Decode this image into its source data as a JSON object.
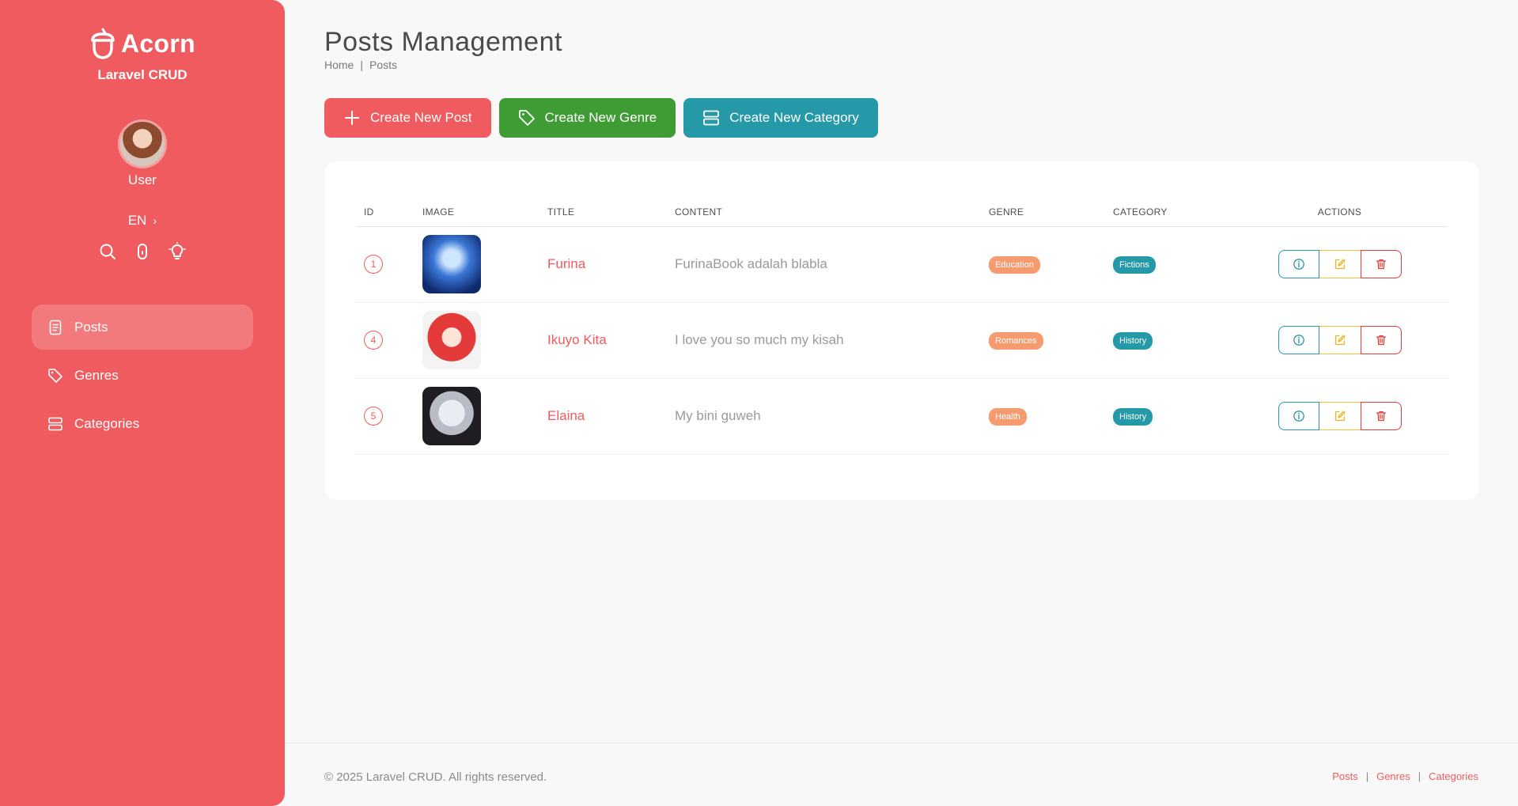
{
  "brand": {
    "name": "Acorn",
    "subtitle": "Laravel CRUD"
  },
  "user": {
    "name": "User"
  },
  "language": {
    "code": "EN"
  },
  "sidebar": {
    "items": [
      {
        "label": "Posts",
        "icon": "document-icon",
        "active": true
      },
      {
        "label": "Genres",
        "icon": "tag-icon",
        "active": false
      },
      {
        "label": "Categories",
        "icon": "category-icon",
        "active": false
      }
    ]
  },
  "page": {
    "title": "Posts Management",
    "breadcrumb": [
      "Home",
      "Posts"
    ]
  },
  "toolbar": {
    "create_post": "Create New Post",
    "create_genre": "Create New Genre",
    "create_category": "Create New Category"
  },
  "table": {
    "headers": [
      "ID",
      "IMAGE",
      "TITLE",
      "CONTENT",
      "GENRE",
      "CATEGORY",
      "ACTIONS"
    ],
    "rows": [
      {
        "id": "1",
        "title": "Furina",
        "content": "FurinaBook adalah blabla",
        "genre": "Education",
        "category": "Fictions"
      },
      {
        "id": "4",
        "title": "Ikuyo Kita",
        "content": "I love you so much my kisah",
        "genre": "Romances",
        "category": "History"
      },
      {
        "id": "5",
        "title": "Elaina",
        "content": "My bini guweh",
        "genre": "Health",
        "category": "History"
      }
    ]
  },
  "footer": {
    "copyright": "© 2025 Laravel CRUD. All rights reserved.",
    "links": [
      "Posts",
      "Genres",
      "Categories"
    ]
  },
  "colors": {
    "primary": "#ef5b5e",
    "success": "#3f9c35",
    "info": "#2599a8",
    "warning": "#f2c138",
    "genre_badge": "#f59b6f"
  }
}
